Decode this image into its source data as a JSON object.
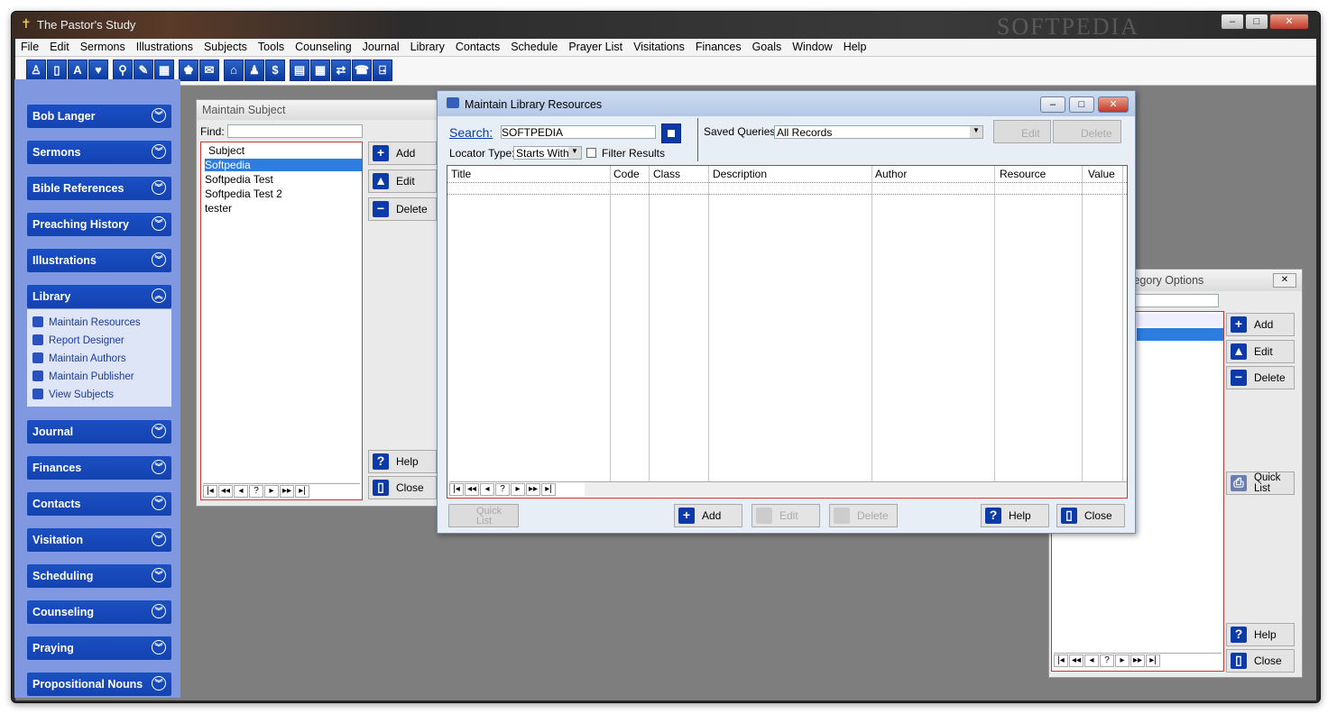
{
  "app": {
    "title": "The Pastor's Study",
    "watermark": "SOFTPEDIA"
  },
  "window_controls": {
    "minimize": "–",
    "maximize": "□",
    "close": "✕"
  },
  "menu": [
    "File",
    "Edit",
    "Sermons",
    "Illustrations",
    "Subjects",
    "Tools",
    "Counseling",
    "Journal",
    "Library",
    "Contacts",
    "Schedule",
    "Prayer List",
    "Visitations",
    "Finances",
    "Goals",
    "Window",
    "Help"
  ],
  "toolbar_icons": [
    "person-icon",
    "book-icon",
    "bible-icon",
    "heart-icon",
    "search-icon",
    "quill-icon",
    "calendar-grid-icon",
    "people-icon",
    "mail-icon",
    "house-icon",
    "person-single-icon",
    "dollar-icon",
    "document-icon",
    "table-icon",
    "transfer-icon",
    "phone-icon",
    "exit-icon"
  ],
  "toolbar_glyphs": [
    "♙",
    "▯",
    "A",
    "♥",
    "⚲",
    "✎",
    "▦",
    "♚",
    "✉",
    "⌂",
    "♟",
    "$",
    "▤",
    "▦",
    "⇄",
    "☎",
    "⍈"
  ],
  "sidebar": {
    "sections": [
      "Bob Langer",
      "Sermons",
      "Bible References",
      "Preaching History",
      "Illustrations",
      "Library",
      "Journal",
      "Finances",
      "Contacts",
      "Visitation",
      "Scheduling",
      "Counseling",
      "Praying",
      "Propositional Nouns"
    ],
    "library_items": [
      "Maintain Resources",
      "Report Designer",
      "Maintain Authors",
      "Maintain Publisher",
      "View Subjects"
    ]
  },
  "subject_window": {
    "title": "Maintain Subject",
    "find_label": "Find:",
    "find_value": "",
    "items": [
      "Subject",
      "Softpedia",
      "Softpedia Test",
      "Softpedia Test 2",
      "tester"
    ],
    "selected_index": 1,
    "buttons": {
      "add": "Add",
      "edit": "Edit",
      "delete": "Delete",
      "help": "Help",
      "close": "Close"
    }
  },
  "nav_buttons": [
    "|◂",
    "◂◂",
    "◂",
    "?",
    "▸",
    "▸▸",
    "▸|"
  ],
  "library_window": {
    "title": "Maintain Library Resources",
    "search_label": "Search:",
    "search_value": "SOFTPEDIA",
    "locator_label": "Locator Type:",
    "locator_value": "Starts With",
    "filter_label": "Filter Results",
    "saved_queries_label": "Saved Queries:",
    "saved_queries_value": "All Records",
    "top_edit": "Edit",
    "top_delete": "Delete",
    "columns": [
      "Title",
      "Code",
      "Class",
      "Description",
      "Author",
      "Resource",
      "Value"
    ],
    "buttons": {
      "quick_list": "Quick List",
      "add": "Add",
      "edit": "Edit",
      "delete": "Delete",
      "help": "Help",
      "close": "Close"
    }
  },
  "category_window": {
    "title": "tegory Options",
    "buttons": {
      "add": "Add",
      "edit": "Edit",
      "delete": "Delete",
      "quick_list": "Quick List",
      "help": "Help",
      "close": "Close"
    }
  }
}
